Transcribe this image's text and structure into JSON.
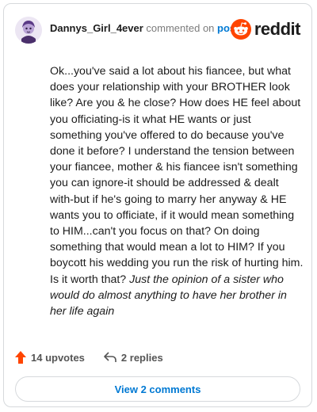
{
  "header": {
    "username": "Dannys_Girl_4ever",
    "action": "commented on",
    "post_link": "post",
    "brand": "reddit"
  },
  "comment": {
    "body_main": "Ok...you've said a lot about his fiancee, but what does your relationship with your BROTHER look like? Are you & he close? How does HE feel about you officiating-is it what HE wants or just something you've offered to do because you've done it before? I understand the tension between your fiancee, mother & his fiancee isn't something you can ignore-it should be addressed & dealt with-but if he's going to marry her anyway & HE wants you to officiate, if it would mean something to HIM...can't you focus on that? On doing something that would mean a lot to HIM? If you boycott his wedding you run the risk of hurting him. Is it worth that?",
    "body_italic": "Just the opinion of a sister who would do almost anything to have her brother in her life again"
  },
  "footer": {
    "upvotes": "14 upvotes",
    "replies": "2 replies",
    "view_comments": "View 2 comments"
  },
  "colors": {
    "accent": "#0079d3",
    "upvote_orange": "#ff4500",
    "border": "#d6d9dc"
  },
  "icons": {
    "avatar": "avatar",
    "brand": "reddit-logo-icon",
    "upvote": "upvote-arrow-icon",
    "reply": "reply-arrow-icon"
  }
}
